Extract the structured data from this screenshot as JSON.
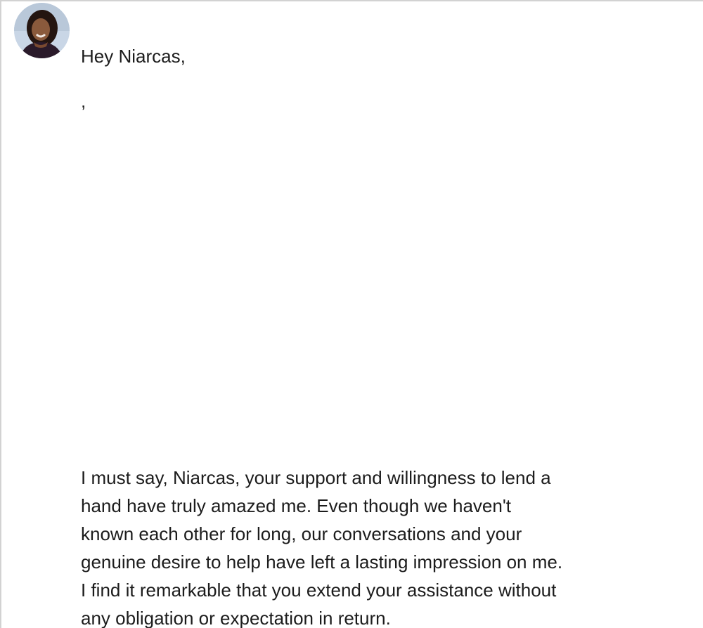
{
  "message": {
    "avatar_icon": "profile-photo",
    "greeting": "Hey Niarcas,",
    "stray_line": ",",
    "body_lines": [
      "I must say, Niarcas, your support and willingness to lend a",
      "hand have truly amazed me. Even though we haven't",
      "known each other for long, our conversations and your",
      "genuine desire to help have left a lasting impression on me.",
      "I find it remarkable that you extend your assistance without",
      "any obligation or expectation in return."
    ]
  }
}
